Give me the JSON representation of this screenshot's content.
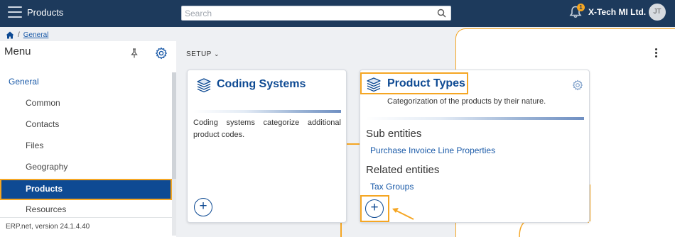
{
  "header": {
    "app_title": "Products",
    "search_placeholder": "Search",
    "notification_count": "1",
    "company": "X-Tech MI Ltd.",
    "avatar_initials": "JT"
  },
  "breadcrumb": {
    "separator": "/",
    "items": [
      "General"
    ]
  },
  "sidebar": {
    "title": "Menu",
    "items": [
      {
        "label": "General"
      },
      {
        "label": "Common"
      },
      {
        "label": "Contacts"
      },
      {
        "label": "Files"
      },
      {
        "label": "Geography"
      },
      {
        "label": "Products"
      },
      {
        "label": "Resources"
      }
    ],
    "version": "ERP.net, version 24.1.4.40"
  },
  "main": {
    "setup_label": "SETUP",
    "cards": [
      {
        "title": "Coding Systems",
        "description": "Coding systems categorize additional product codes.",
        "add_label": "+"
      },
      {
        "title": "Product Types",
        "description": "Categorization of the products by their nature.",
        "sub_entities_title": "Sub entities",
        "sub_entities": [
          "Purchase Invoice Line Properties"
        ],
        "related_entities_title": "Related entities",
        "related_entities": [
          "Tax Groups"
        ],
        "add_label": "+"
      }
    ]
  },
  "colors": {
    "header_bg": "#1d3a5c",
    "accent": "#0e4a93",
    "highlight": "#f5a623",
    "link": "#1a5aa8"
  },
  "icons": [
    "hamburger-icon",
    "search-icon",
    "bell-icon",
    "home-icon",
    "pin-icon",
    "gear-icon",
    "layers-icon",
    "kebab-icon",
    "arrow-icon"
  ]
}
